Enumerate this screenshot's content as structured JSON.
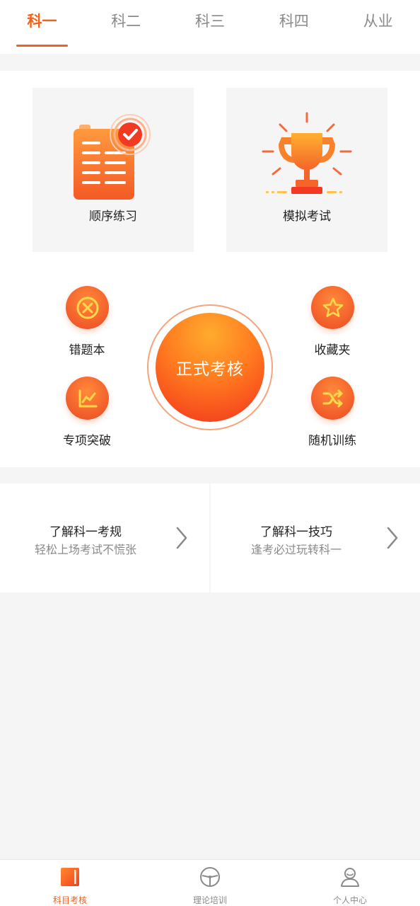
{
  "tabs": [
    {
      "label": "科一",
      "active": true
    },
    {
      "label": "科二",
      "active": false
    },
    {
      "label": "科三",
      "active": false
    },
    {
      "label": "科四",
      "active": false
    },
    {
      "label": "从业",
      "active": false
    }
  ],
  "cards": {
    "sequential_practice": {
      "label": "顺序练习",
      "icon": "checklist-document-icon"
    },
    "mock_exam": {
      "label": "模拟考试",
      "icon": "trophy-icon"
    }
  },
  "actions": {
    "wrong_questions": {
      "label": "错题本",
      "icon": "x-circle-icon"
    },
    "favorites": {
      "label": "收藏夹",
      "icon": "star-icon"
    },
    "special_breakthrough": {
      "label": "专项突破",
      "icon": "line-chart-icon"
    },
    "random_training": {
      "label": "随机训练",
      "icon": "shuffle-icon"
    },
    "formal_exam": {
      "label": "正式考核"
    }
  },
  "info": [
    {
      "title": "了解科一考规",
      "subtitle": "轻松上场考试不慌张"
    },
    {
      "title": "了解科一技巧",
      "subtitle": "逢考必过玩转科一"
    }
  ],
  "bottom_nav": [
    {
      "label": "科目考核",
      "icon": "book-icon",
      "active": true
    },
    {
      "label": "理论培训",
      "icon": "steering-wheel-icon",
      "active": false
    },
    {
      "label": "个人中心",
      "icon": "user-icon",
      "active": false
    }
  ],
  "colors": {
    "accent": "#f0621c",
    "gradient_top": "#ffab2e",
    "gradient_bottom": "#f2331d",
    "text_muted": "#8a8a8a",
    "background": "#f5f5f5"
  }
}
